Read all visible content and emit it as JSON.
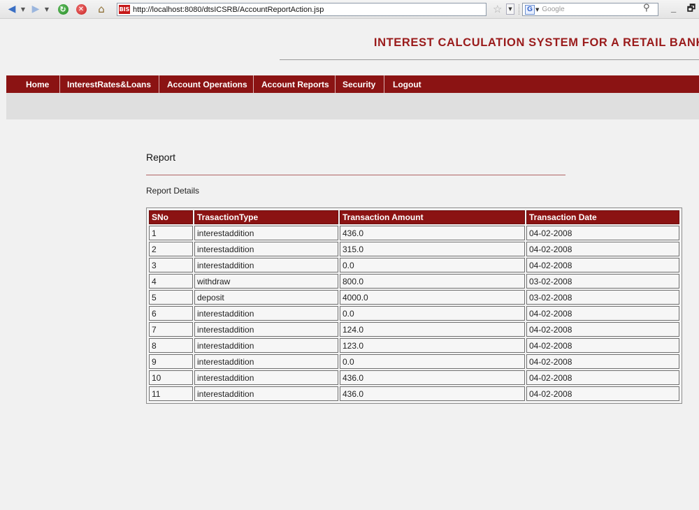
{
  "browser": {
    "url": "http://localhost:8080/dtsICSRB/AccountReportAction.jsp",
    "favicon_text": "BIS",
    "search_placeholder": "Google",
    "window_buttons": "_ 🗗 x"
  },
  "header": {
    "title": "INTEREST CALCULATION SYSTEM FOR A RETAIL BANK"
  },
  "menu": {
    "items": [
      {
        "label": "Home"
      },
      {
        "label": "InterestRates&Loans"
      },
      {
        "label": "Account Operations"
      },
      {
        "label": "Account Reports"
      },
      {
        "label": "Security"
      },
      {
        "label": "Logout"
      }
    ]
  },
  "report": {
    "heading": "Report",
    "subheading": "Report Details",
    "columns": [
      "SNo",
      "TrasactionType",
      "Transaction Amount",
      "Transaction Date"
    ],
    "rows": [
      [
        "1",
        "interestaddition",
        "436.0",
        "04-02-2008"
      ],
      [
        "2",
        "interestaddition",
        "315.0",
        "04-02-2008"
      ],
      [
        "3",
        "interestaddition",
        "0.0",
        "04-02-2008"
      ],
      [
        "4",
        "withdraw",
        "800.0",
        "03-02-2008"
      ],
      [
        "5",
        "deposit",
        "4000.0",
        "03-02-2008"
      ],
      [
        "6",
        "interestaddition",
        "0.0",
        "04-02-2008"
      ],
      [
        "7",
        "interestaddition",
        "124.0",
        "04-02-2008"
      ],
      [
        "8",
        "interestaddition",
        "123.0",
        "04-02-2008"
      ],
      [
        "9",
        "interestaddition",
        "0.0",
        "04-02-2008"
      ],
      [
        "10",
        "interestaddition",
        "436.0",
        "04-02-2008"
      ],
      [
        "11",
        "interestaddition",
        "436.0",
        "04-02-2008"
      ]
    ]
  },
  "colors": {
    "brand": "#8b1313",
    "title": "#9a1b1b"
  }
}
